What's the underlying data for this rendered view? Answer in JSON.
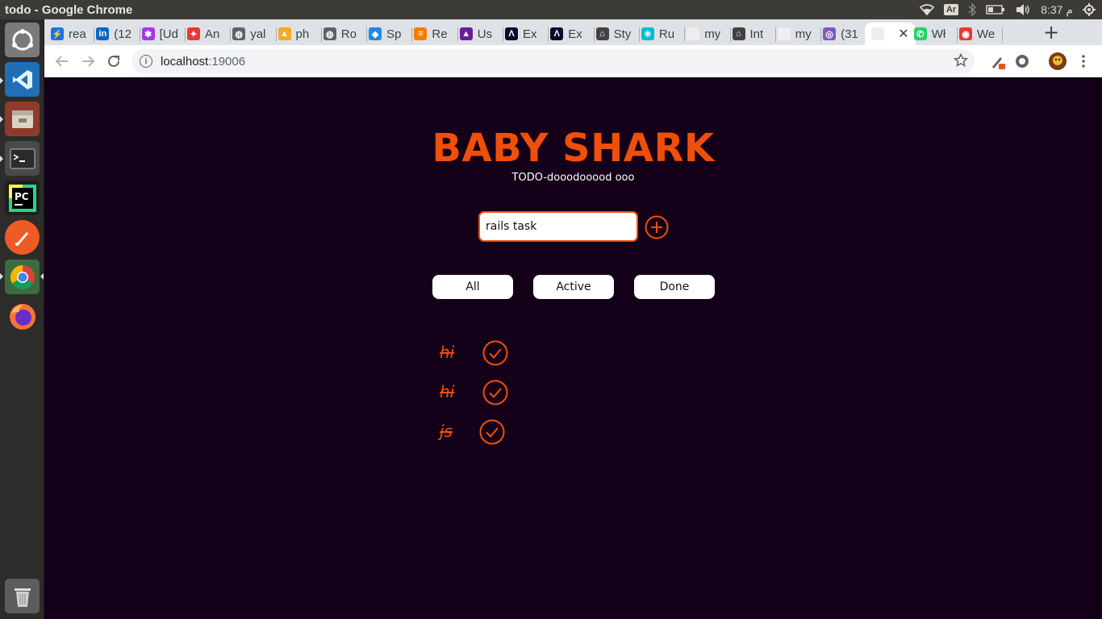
{
  "window": {
    "title": "todo - Google Chrome"
  },
  "system_tray": {
    "keyboard_layout": "Ar",
    "clock": "8:37 م"
  },
  "launcher": {
    "apps": [
      {
        "name": "Ubuntu Dash",
        "icon": "ubuntu-dash-icon"
      },
      {
        "name": "Visual Studio Code",
        "icon": "vscode-icon"
      },
      {
        "name": "Files",
        "icon": "files-icon"
      },
      {
        "name": "Terminal",
        "icon": "terminal-icon"
      },
      {
        "name": "PyCharm",
        "icon": "pycharm-icon"
      },
      {
        "name": "Postman",
        "icon": "postman-icon"
      },
      {
        "name": "Google Chrome",
        "icon": "chrome-icon"
      },
      {
        "name": "Firefox",
        "icon": "firefox-icon"
      },
      {
        "name": "Trash",
        "icon": "trash-icon"
      }
    ]
  },
  "tabs": [
    {
      "label": "rea",
      "favicon_color": "#1a73e8",
      "favicon_glyph": "⚡"
    },
    {
      "label": "(12",
      "favicon_color": "#0a66c2",
      "favicon_glyph": "in"
    },
    {
      "label": "[Ud",
      "favicon_color": "#a435f0",
      "favicon_glyph": "✱"
    },
    {
      "label": "An",
      "favicon_color": "#e53935",
      "favicon_glyph": "✦"
    },
    {
      "label": "yal",
      "favicon_color": "#5f6368",
      "favicon_glyph": "◍"
    },
    {
      "label": "ph",
      "favicon_color": "#f9a825",
      "favicon_glyph": "▲"
    },
    {
      "label": "Ro",
      "favicon_color": "#5f6368",
      "favicon_glyph": "◍"
    },
    {
      "label": "Sp",
      "favicon_color": "#1e88e5",
      "favicon_glyph": "◆"
    },
    {
      "label": "Re",
      "favicon_color": "#f57c00",
      "favicon_glyph": "≡"
    },
    {
      "label": "Us",
      "favicon_color": "#6a1b9a",
      "favicon_glyph": "▲"
    },
    {
      "label": "Ex",
      "favicon_color": "#0b0b2b",
      "favicon_glyph": "Λ"
    },
    {
      "label": "Ex",
      "favicon_color": "#0b0b2b",
      "favicon_glyph": "Λ"
    },
    {
      "label": "Sty",
      "favicon_color": "#424242",
      "favicon_glyph": "⌂"
    },
    {
      "label": "Ru",
      "favicon_color": "#00bcd4",
      "favicon_glyph": "⚛"
    },
    {
      "label": "my",
      "favicon_color": "#eeeeee",
      "favicon_glyph": ""
    },
    {
      "label": "Int",
      "favicon_color": "#424242",
      "favicon_glyph": "⌂"
    },
    {
      "label": "my",
      "favicon_color": "#eeeeee",
      "favicon_glyph": ""
    },
    {
      "label": "(31",
      "favicon_color": "#7e57c2",
      "favicon_glyph": "◎"
    },
    {
      "label": "",
      "favicon_color": "#eeeeee",
      "favicon_glyph": "",
      "active": true
    },
    {
      "label": "Wł",
      "favicon_color": "#25d366",
      "favicon_glyph": "✆"
    },
    {
      "label": "We",
      "favicon_color": "#e53935",
      "favicon_glyph": "◉"
    }
  ],
  "toolbar": {
    "url_host": "localhost",
    "url_port": ":19006"
  },
  "app": {
    "title": "BABY SHARK",
    "subtitle": "TODO-dooodooood ooo",
    "input_value": "rails task",
    "filters": [
      "All",
      "Active",
      "Done"
    ],
    "todos": [
      {
        "text": "hi",
        "done": true
      },
      {
        "text": "hi",
        "done": true
      },
      {
        "text": "js",
        "done": true
      }
    ],
    "accent_color": "#f04e0b",
    "background_color": "#140018"
  }
}
